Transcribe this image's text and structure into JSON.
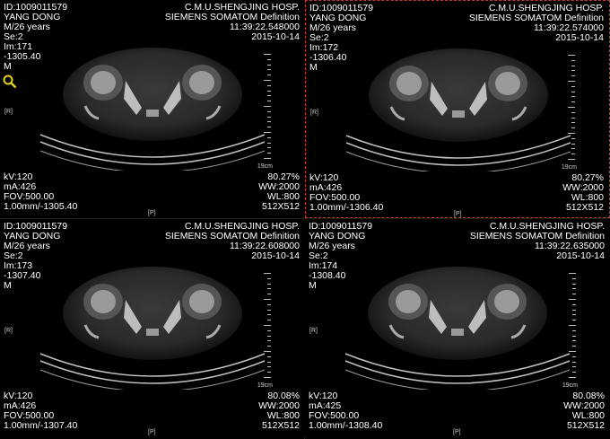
{
  "viewports": [
    {
      "id": "ID:1009011579",
      "name": "YANG DONG",
      "age": "M/26 years",
      "series": "Se:2",
      "image": "Im:171",
      "position": "-1305.40",
      "orientation": "M",
      "hospital": "C.M.U.SHENGJING HOSP.",
      "scanner": "SIEMENS SOMATOM Definition",
      "time": "11:39:22.548000",
      "date": "2015-10-14",
      "kv": "kV:120",
      "ma": "mA:426",
      "fov": "FOV:500.00",
      "slice": "1.00mm/-1305.40",
      "zoom": "80.27%",
      "ww": "WW:2000",
      "wl": "WL:800",
      "matrix": "512X512",
      "left_marker": "[R]",
      "bottom_marker": "[P]",
      "scale": "19cm"
    },
    {
      "id": "ID:1009011579",
      "name": "YANG DONG",
      "age": "M/26 years",
      "series": "Se:2",
      "image": "Im:172",
      "position": "-1306.40",
      "orientation": "M",
      "hospital": "C.M.U.SHENGJING HOSP.",
      "scanner": "SIEMENS SOMATOM Definition",
      "time": "11:39:22.574000",
      "date": "2015-10-14",
      "kv": "kV:120",
      "ma": "mA:426",
      "fov": "FOV:500.00",
      "slice": "1.00mm/-1306.40",
      "zoom": "80.27%",
      "ww": "WW:2000",
      "wl": "WL:800",
      "matrix": "512X512",
      "left_marker": "[R]",
      "bottom_marker": "[P]",
      "scale": "19cm"
    },
    {
      "id": "ID:1009011579",
      "name": "YANG DONG",
      "age": "M/26 years",
      "series": "Se:2",
      "image": "Im:173",
      "position": "-1307.40",
      "orientation": "M",
      "hospital": "C.M.U.SHENGJING HOSP.",
      "scanner": "SIEMENS SOMATOM Definition",
      "time": "11:39:22.608000",
      "date": "2015-10-14",
      "kv": "kV:120",
      "ma": "mA:426",
      "fov": "FOV:500.00",
      "slice": "1.00mm/-1307.40",
      "zoom": "80.08%",
      "ww": "WW:2000",
      "wl": "WL:800",
      "matrix": "512X512",
      "left_marker": "[R]",
      "bottom_marker": "[P]",
      "scale": "19cm"
    },
    {
      "id": "ID:1009011579",
      "name": "YANG DONG",
      "age": "M/26 years",
      "series": "Se:2",
      "image": "Im:174",
      "position": "-1308.40",
      "orientation": "M",
      "hospital": "C.M.U.SHENGJING HOSP.",
      "scanner": "SIEMENS SOMATOM Definition",
      "time": "11:39:22.635000",
      "date": "2015-10-14",
      "kv": "kV:120",
      "ma": "mA:425",
      "fov": "FOV:500.00",
      "slice": "1.00mm/-1308.40",
      "zoom": "80.08%",
      "ww": "WW:2000",
      "wl": "WL:800",
      "matrix": "512X512",
      "left_marker": "[R]",
      "bottom_marker": "[P]",
      "scale": "19cm"
    }
  ],
  "active_viewport": 1,
  "icons": {
    "zoom_tool": "magnifier-icon"
  },
  "colors": {
    "text": "#ffffff",
    "active_border": "#c23a3a",
    "background": "#000000",
    "zoom_icon": "#e6d21a"
  }
}
